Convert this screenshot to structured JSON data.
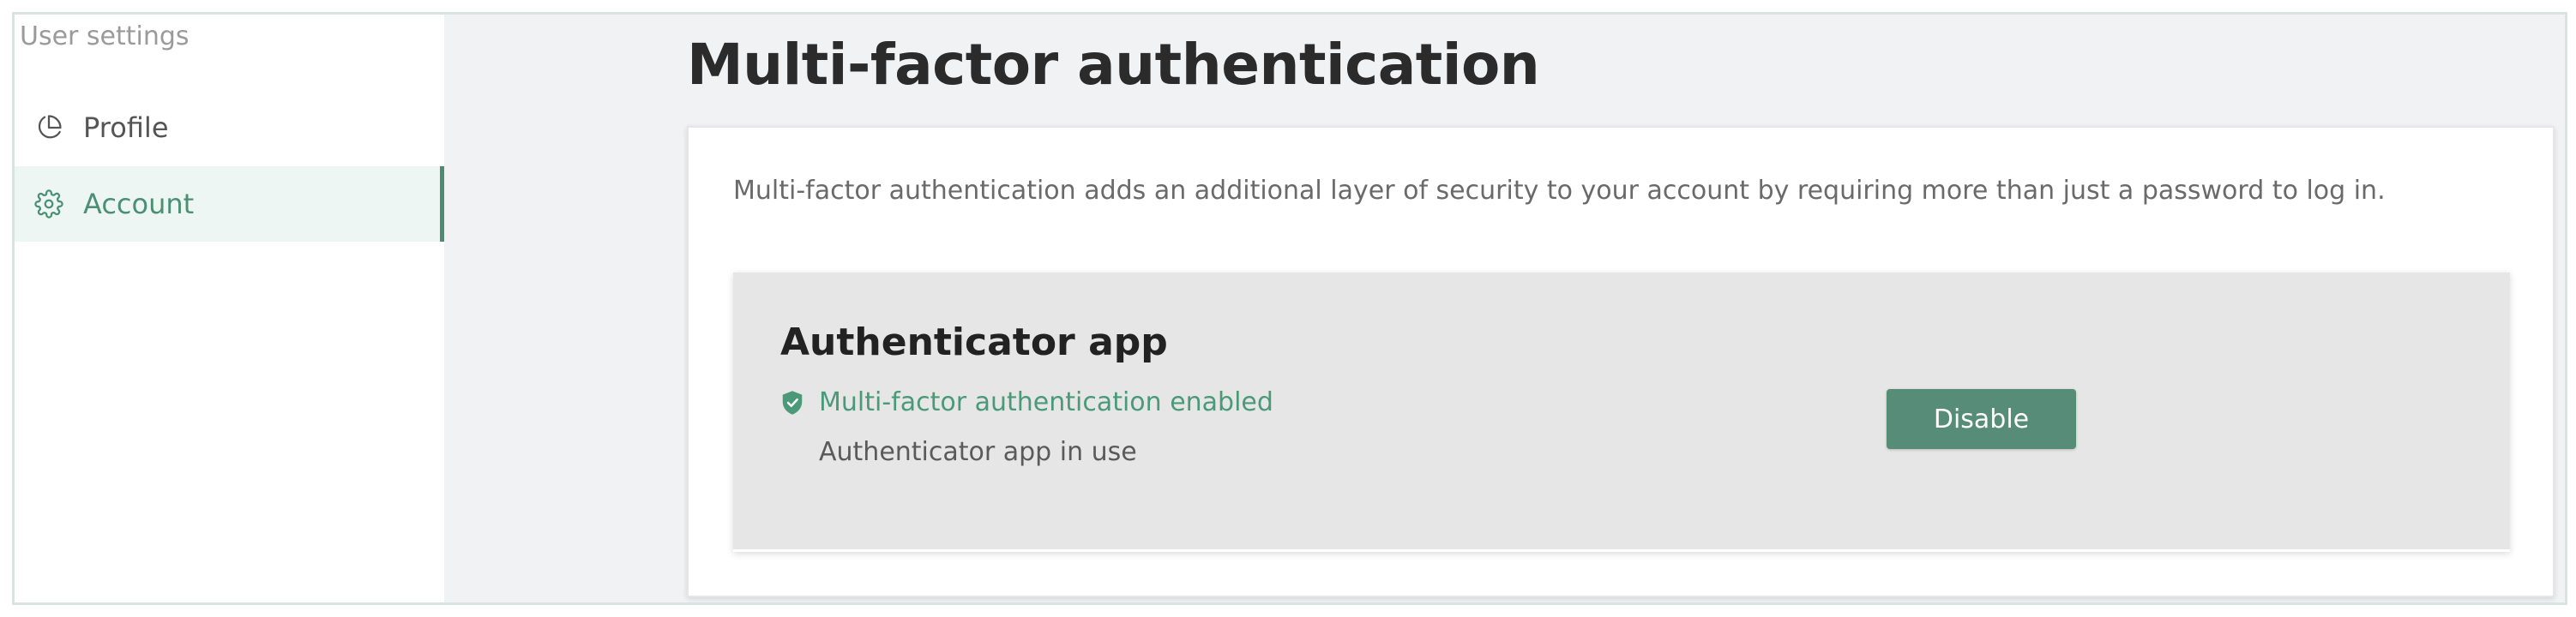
{
  "sidebar": {
    "heading": "User settings",
    "items": [
      {
        "label": "Profile",
        "icon": "pie-chart-icon",
        "active": false
      },
      {
        "label": "Account",
        "icon": "gear-icon",
        "active": true
      }
    ]
  },
  "main": {
    "title": "Multi-factor authentication",
    "description": "Multi-factor authentication adds an additional layer of security to your account by requiring more than just a password to log in.",
    "panel": {
      "title": "Authenticator app",
      "status": "Multi-factor authentication enabled",
      "status_icon": "shield-check-icon",
      "sub_status": "Authenticator app in use",
      "button_label": "Disable"
    }
  },
  "colors": {
    "accent": "#4f8a73",
    "status_green": "#4a9a7a",
    "active_nav_bg": "#eef6f3",
    "main_bg": "#f1f2f4",
    "panel_bg": "#e6e6e6"
  }
}
